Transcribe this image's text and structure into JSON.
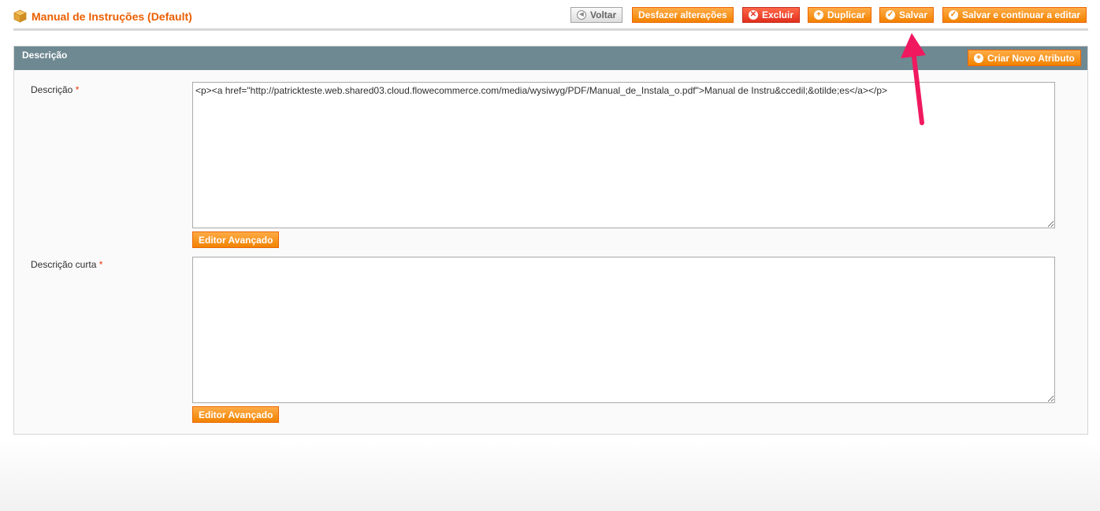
{
  "header": {
    "title": "Manual de Instruções (Default)",
    "buttons": {
      "back": "Voltar",
      "reset": "Desfazer alterações",
      "delete": "Excluir",
      "duplicate": "Duplicar",
      "save": "Salvar",
      "save_continue": "Salvar e continuar a editar"
    }
  },
  "section": {
    "title": "Descrição",
    "create_attribute": "Criar Novo Atributo"
  },
  "fields": {
    "description": {
      "label": "Descrição",
      "required_mark": "*",
      "value": "<p><a href=\"http://patrickteste.web.shared03.cloud.flowecommerce.com/media/wysiwyg/PDF/Manual_de_Instala_o.pdf\">Manual de Instru&ccedil;&otilde;es</a></p>",
      "editor_button": "Editor Avançado"
    },
    "short_description": {
      "label": "Descrição curta",
      "required_mark": "*",
      "value": "",
      "editor_button": "Editor Avançado"
    }
  },
  "colors": {
    "accent": "#eb5e00",
    "button_orange": "#f18200",
    "section_header": "#6f8992",
    "annotation_arrow": "#f0195f"
  },
  "icons": {
    "title": "package-icon",
    "back": "arrow-left-circle-icon",
    "delete": "x-circle-icon",
    "add": "plus-circle-icon",
    "check": "check-circle-icon"
  }
}
